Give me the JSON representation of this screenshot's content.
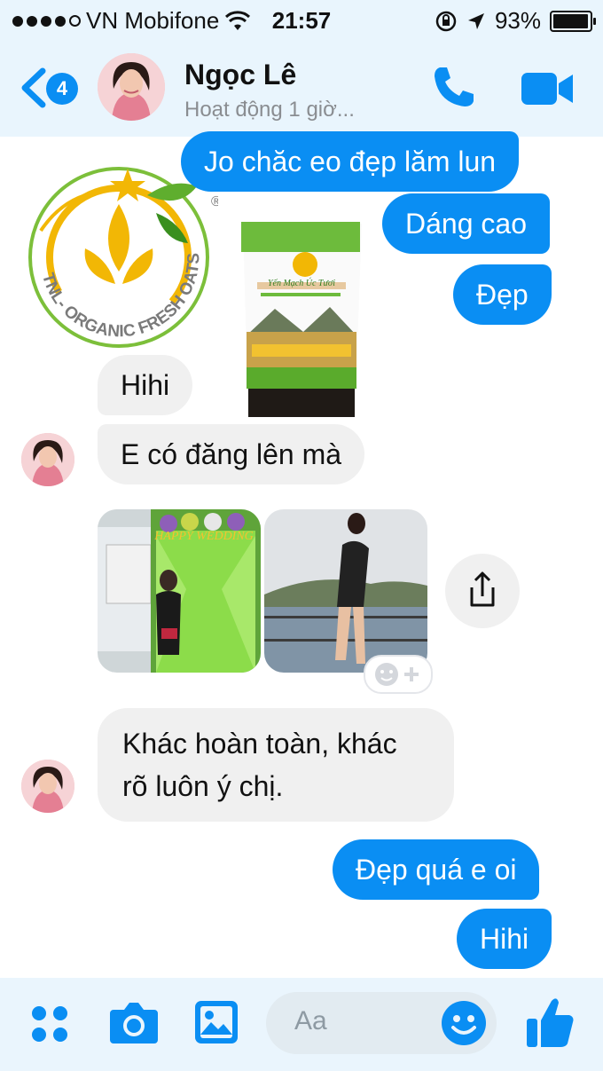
{
  "status_bar": {
    "carrier": "VN Mobifone",
    "time": "21:57",
    "battery": "93%",
    "battery_level": 0.93
  },
  "header": {
    "back_badge": "4",
    "contact_name": "Ngọc Lê",
    "activity": "Hoạt động 1 giờ...",
    "call_icon": "phone-icon",
    "video_icon": "video-camera-icon"
  },
  "shared_images": {
    "logo_text": "TNL- ORGANIC FRESH OATS",
    "logo_mark": "®",
    "product_label": "Yến Mạch Úc Tươi"
  },
  "messages": [
    {
      "from": "me",
      "text": "Jo chăc eo đẹp lăm lun"
    },
    {
      "from": "me",
      "text": "Dáng cao"
    },
    {
      "from": "me",
      "text": "Đẹp"
    },
    {
      "from": "them",
      "text": "Hihi"
    },
    {
      "from": "them",
      "text": "E có đăng lên mà"
    },
    {
      "from": "them",
      "text_lines": [
        "Khác hoàn toàn, khác",
        "rõ luôn ý chị."
      ]
    },
    {
      "from": "me",
      "text": "Đẹp quá e oi"
    },
    {
      "from": "me",
      "text": "Hihi"
    }
  ],
  "photo_banner": "HAPPY WEDDING",
  "composer": {
    "placeholder": "Aa",
    "icons": [
      "apps-icon",
      "camera-icon",
      "gallery-icon",
      "emoji-icon",
      "thumbs-up-icon"
    ]
  },
  "colors": {
    "accent": "#0a8ef3",
    "incoming_bubble": "#f0f0f0",
    "header_bg": "#e9f5fd"
  }
}
